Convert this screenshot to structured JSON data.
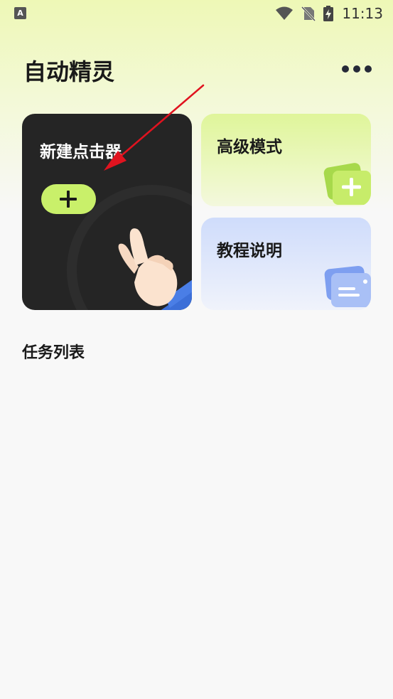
{
  "status_bar": {
    "app_icon_letter": "A",
    "time": "11:13"
  },
  "header": {
    "title": "自动精灵"
  },
  "cards": {
    "new_clicker": {
      "title": "新建点击器"
    },
    "advanced_mode": {
      "title": "高级模式"
    },
    "tutorial": {
      "title": "教程说明"
    }
  },
  "sections": {
    "task_list": "任务列表"
  },
  "colors": {
    "accent_lime": "#c9f06a",
    "dark_card": "#252525",
    "annotation_arrow": "#e0131f"
  }
}
